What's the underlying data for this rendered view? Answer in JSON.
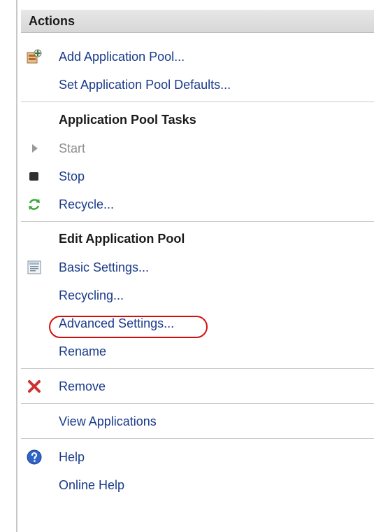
{
  "header": {
    "title": "Actions"
  },
  "items": {
    "add_pool": "Add Application Pool...",
    "set_defaults": "Set Application Pool Defaults...",
    "tasks_section": "Application Pool Tasks",
    "start": "Start",
    "stop": "Stop",
    "recycle": "Recycle...",
    "edit_section": "Edit Application Pool",
    "basic_settings": "Basic Settings...",
    "recycling": "Recycling...",
    "advanced_settings": "Advanced Settings...",
    "rename": "Rename",
    "remove": "Remove",
    "view_applications": "View Applications",
    "help": "Help",
    "online_help": "Online Help"
  },
  "colors": {
    "link": "#1a3a8a",
    "disabled": "#8d8d8d",
    "highlight": "#d20f0f",
    "header_bg": "#dedede"
  }
}
